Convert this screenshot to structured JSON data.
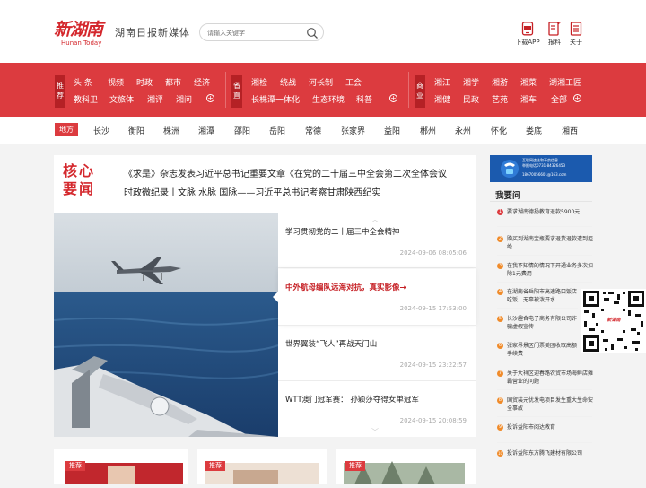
{
  "header": {
    "logo_cn": "新湖南",
    "logo_en": "Hunan Today",
    "slogan": "湖南日报新媒体",
    "search_placeholder": "请输入关键字",
    "icons": [
      {
        "label": "下载APP",
        "icon": "app-download-icon"
      },
      {
        "label": "报料",
        "icon": "report-icon"
      },
      {
        "label": "关于",
        "icon": "about-icon"
      }
    ]
  },
  "nav": {
    "groups": [
      {
        "tag": "推荐",
        "row1": [
          "头 条",
          "视频",
          "时政",
          "都市",
          "经济"
        ],
        "row2": [
          "教科卫",
          "文旅体",
          "湘评",
          "湘问"
        ]
      },
      {
        "tag": "省直",
        "row1": [
          "湘检",
          "统战",
          "河长制",
          "工会"
        ],
        "row2": [
          "长株潭一体化",
          "生态环境",
          "科普"
        ]
      },
      {
        "tag": "商业",
        "row1": [
          "湘江",
          "湘学",
          "湘游",
          "湘菜",
          "湖湘工匠"
        ],
        "row2": [
          "湘健",
          "民政",
          "艺苑",
          "湘车",
          "全部"
        ]
      }
    ],
    "plus": "+"
  },
  "cities": {
    "tag": "地方",
    "items": [
      "长沙",
      "衡阳",
      "株洲",
      "湘潭",
      "邵阳",
      "岳阳",
      "常德",
      "张家界",
      "益阳",
      "郴州",
      "永州",
      "怀化",
      "娄底",
      "湘西"
    ]
  },
  "core": {
    "tag_line1": "核心",
    "tag_line2": "要闻",
    "headlines": [
      "《求是》杂志发表习近平总书记重要文章《在党的二十届三中全会第二次全体会议",
      "时政微纪录丨文脉 水脉 国脉——习近平总书记考察甘肃陕西纪实"
    ]
  },
  "news": [
    {
      "title": "学习贯彻党的二十届三中全会精神",
      "date": "2024-09-06 08:05:06",
      "active": false
    },
    {
      "title": "中外航母编队远海对抗，真实影像→",
      "date": "2024-09-15 17:53:00",
      "active": true
    },
    {
      "title": "世界翼装“飞人”再战天门山",
      "date": "2024-09-15 23:22:57",
      "active": false
    },
    {
      "title": "WTT澳门冠军赛： 孙颖莎夺得女单冠军",
      "date": "2024-09-15 20:08:59",
      "active": false
    }
  ],
  "cards": [
    {
      "tag": "推荐"
    },
    {
      "tag": "推荐"
    },
    {
      "tag": "推荐"
    }
  ],
  "sidebar": {
    "ad_text_1": "互联网违法和不良信息",
    "ad_text_2": "举报电话",
    "ad_text_3": "0731-84326453",
    "ad_text_4": "18670056601@163.com",
    "title": "我要问",
    "questions": [
      {
        "n": "1",
        "text": "要求湖南德扬教育退款5900元"
      },
      {
        "n": "2",
        "text": "购买到湖南宝瓶要求退货退款遭到拒绝"
      },
      {
        "n": "3",
        "text": "在我不知情的情况下开通业务多次扣除1元费用"
      },
      {
        "n": "4",
        "text": "在湖南省岳阳市高速路口饭店吃饭，无辜被泼开水"
      },
      {
        "n": "5",
        "text": "长沙趣合电子商务有限公司诈骗虚假宣传"
      },
      {
        "n": "6",
        "text": "张家界景区门票美团收取高额手续费"
      },
      {
        "n": "7",
        "text": "关于大祥区迎春路农贸市场海鲜店摊霸营业的问题"
      },
      {
        "n": "8",
        "text": "国贸装元优发电项目发生重大生命安全事故"
      },
      {
        "n": "9",
        "text": "投诉益阳市阅达教育"
      },
      {
        "n": "10",
        "text": "投诉益阳东方腾飞建材有限公司"
      }
    ],
    "qr_label": "新湖南"
  },
  "colors": {
    "brand_red": "#dc3b3f",
    "dark_red": "#b52125"
  }
}
